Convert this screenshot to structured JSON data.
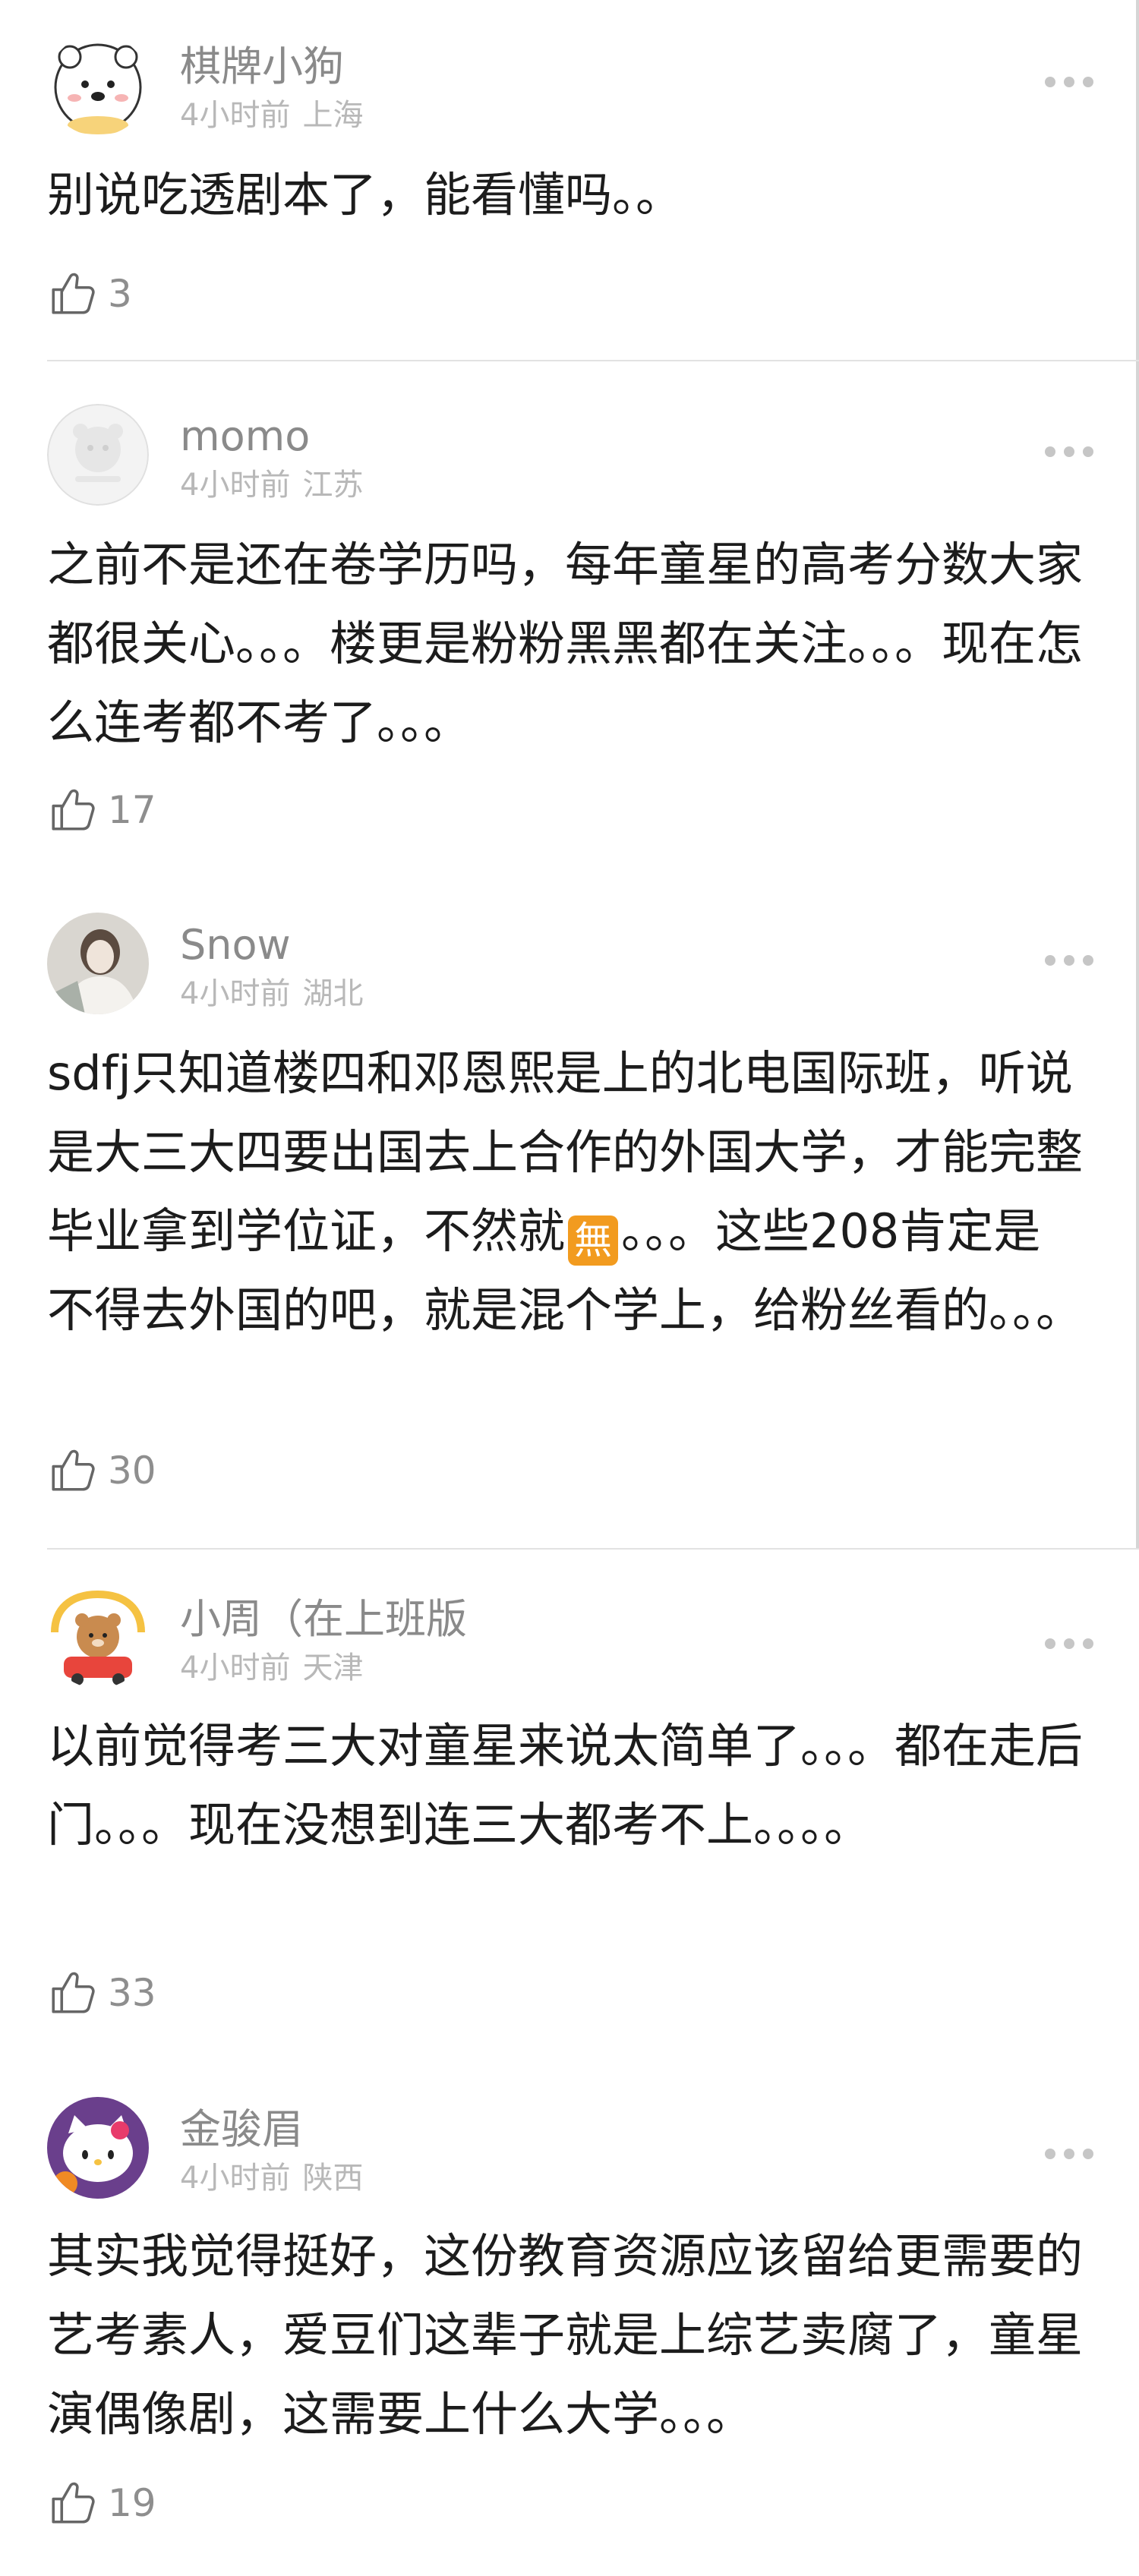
{
  "comments": [
    {
      "user": "棋牌小狗",
      "time": "4小时前",
      "location": "上海",
      "text": "别说吃透剧本了，能看懂吗。。",
      "likes": "3",
      "avatar_icon": "white-bear-avatar"
    },
    {
      "user": "momo",
      "time": "4小时前",
      "location": "江苏",
      "text": "之前不是还在卷学历吗，每年童星的高考分数大家都很关心。。。楼更是粉粉黑黑都在关注。。。现在怎么连考都不考了。。。",
      "likes": "17",
      "avatar_icon": "default-bear-avatar"
    },
    {
      "user": "Snow",
      "time": "4小时前",
      "location": "湖北",
      "text_before_emoji": "sdfj只知道楼四和邓恩熙是上的北电国际班，听说是大三大四要出国去上合作的外国大学，才能完整毕业拿到学位证，不然就",
      "emoji": "無",
      "text_after_emoji": "。。。这些208肯定是不得去外国的吧，就是混个学上，给粉丝看的。。。",
      "likes": "30",
      "avatar_icon": "person-photo-avatar"
    },
    {
      "user": "小周（在上班版",
      "time": "4小时前",
      "location": "天津",
      "text": "以前觉得考三大对童星来说太简单了。。。都在走后门。。。现在没想到连三大都考不上。。。。",
      "likes": "33",
      "avatar_icon": "bear-in-car-avatar"
    },
    {
      "user": "金骏眉",
      "time": "4小时前",
      "location": "陕西",
      "text": "其实我觉得挺好，这份教育资源应该留给更需要的艺考素人，爱豆们这辈子就是上综艺卖腐了，童星演偶像剧，这需要上什么大学。。。",
      "likes": "19",
      "avatar_icon": "hello-kitty-avatar"
    }
  ],
  "colors": {
    "name": "#8a8a8a",
    "meta": "#b8b8b8",
    "text": "#1c1c1c",
    "emoji_bg": "#f29b1f",
    "divider": "#e2e2e2"
  }
}
